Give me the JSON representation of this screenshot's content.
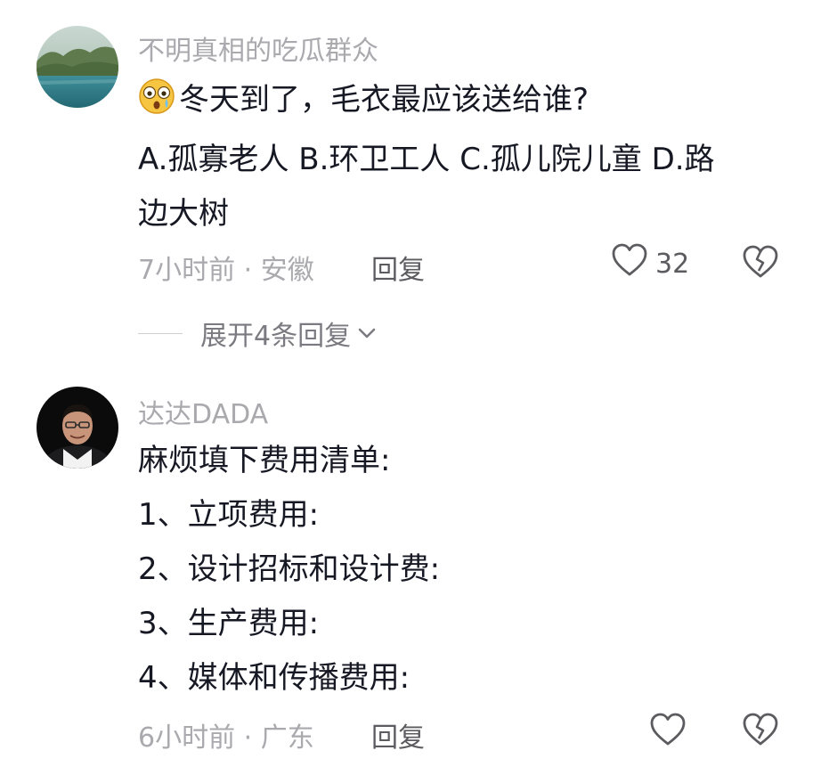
{
  "comments": [
    {
      "username": "不明真相的吃瓜群众",
      "emoji_icon": "astonished-face-emoji",
      "lines": [
        "冬天到了，毛衣最应该送给谁?",
        "A.孤寡老人 B.环卫工人 C.孤儿院儿童 D.路",
        "边大树"
      ],
      "time_location": "7小时前 · 安徽",
      "reply_label": "回复",
      "like_count": "32",
      "expand_label": "展开4条回复"
    },
    {
      "username": "达达DADA",
      "lines": [
        "麻烦填下费用清单:",
        "1、立项费用:",
        "2、设计招标和设计费:",
        "3、生产费用:",
        "4、媒体和传播费用:"
      ],
      "time_location": "6小时前 · 广东",
      "reply_label": "回复"
    }
  ],
  "icons": {
    "like": "heart-outline-icon",
    "dislike": "broken-heart-icon",
    "expand": "chevron-down-icon"
  },
  "colors": {
    "text": "#161823",
    "secondary": "#a9a9ae",
    "action": "#5b5b60"
  }
}
